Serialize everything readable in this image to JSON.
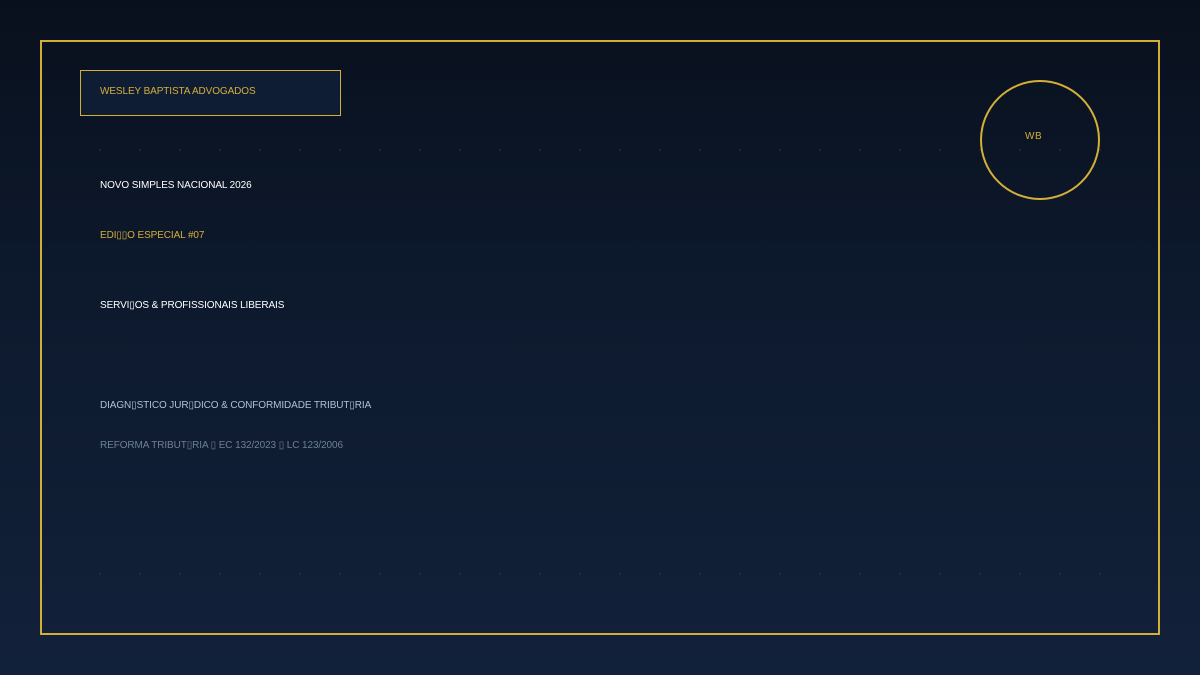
{
  "brand": {
    "name": "WESLEY BAPTISTA ADVOGADOS",
    "monogram": "WB"
  },
  "headline": {
    "title": "NOVO SIMPLES NACIONAL 2026",
    "edition": "EDI▯▯O ESPECIAL #07",
    "segment": "SERVI▯OS & PROFISSIONAIS LIBERAIS"
  },
  "footer": {
    "diagnostic": "DIAGN▯STICO JUR▯DICO & CONFORMIDADE TRIBUT▯RIA",
    "reform": "REFORMA TRIBUT▯RIA ▯ EC 132/2023 ▯ LC 123/2006"
  },
  "colors": {
    "background_top": "#09101d",
    "background_bottom": "#12213a",
    "accent_gold": "#d4af37",
    "text_white": "#ffffff",
    "text_muted": "#b4bfd0",
    "text_dim": "#6f7f98"
  }
}
